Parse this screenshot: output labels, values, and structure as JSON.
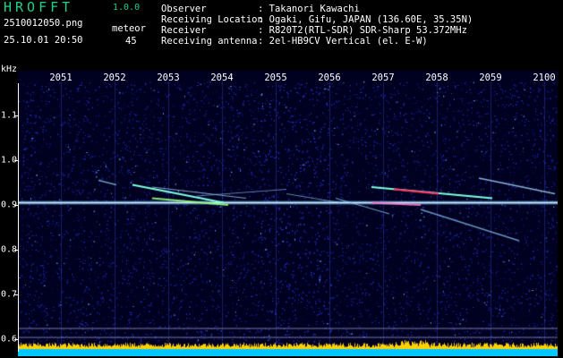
{
  "header": {
    "app_title": "HROFFT",
    "app_version": "1.0.0",
    "file_name": "2510012050.png",
    "datetime": "25.10.01 20:50",
    "meteor_label": "meteor",
    "meteor_count": "45"
  },
  "station_info": [
    {
      "key": "Observer",
      "value": ": Takanori Kawachi"
    },
    {
      "key": "Receiving Location",
      "value": ": Ogaki, Gifu, JAPAN (136.60E, 35.35N)"
    },
    {
      "key": "Receiver",
      "value": ": R820T2(RTL-SDR) SDR-Sharp 53.372MHz"
    },
    {
      "key": "Receiving antenna",
      "value": ": 2el-HB9CV Vertical (el. E-W)"
    }
  ],
  "spectrogram": {
    "freq_unit": "kHz",
    "time_labels": [
      "2051",
      "2052",
      "2053",
      "2054",
      "2055",
      "2056",
      "2057",
      "2058",
      "2059",
      "2100"
    ],
    "freq_labels": [
      "1.1",
      "1.0",
      "0.9",
      "0.8",
      "0.7",
      "0.6"
    ],
    "freq_range_khz": [
      0.58,
      1.18
    ],
    "carrier_khz": 0.905,
    "colors": {
      "background": "#000020",
      "noise": "#2a35c8",
      "carrier": "#c8f0ff",
      "meteor": "#7fffe0",
      "strong": "#ff3060",
      "level_bar": "#ffd000",
      "level_base": "#00c8ff"
    }
  }
}
